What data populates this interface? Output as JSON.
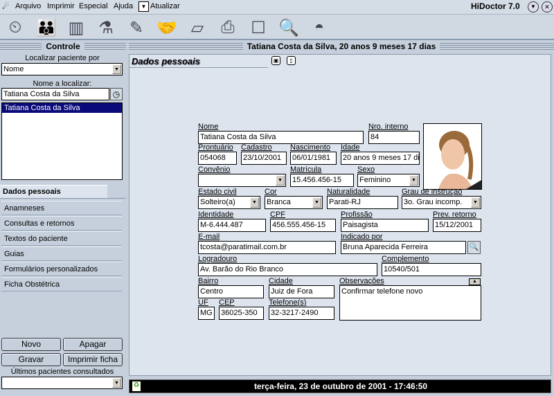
{
  "menu": {
    "items": [
      "Arquivo",
      "Imprimir",
      "Especial",
      "Ajuda"
    ],
    "refresh": "Atualizar",
    "app_title": "HiDoctor 7.0"
  },
  "toolbar": {
    "icons": [
      "agenda-icon",
      "patients-icon",
      "files-icon",
      "lab-icon",
      "notes-icon",
      "handshake-icon",
      "book-icon",
      "printer-icon",
      "device-icon",
      "search-globe-icon",
      "chart-icon"
    ]
  },
  "sidebar": {
    "header": "Controle",
    "search_by_label": "Localizar paciente por",
    "search_by_value": "Nome",
    "name_label": "Nome a localizar:",
    "name_value": "Tatiana Costa da Silva",
    "results": [
      "Tatiana Costa da Silva"
    ],
    "tabs": [
      "Dados pessoais",
      "Anamneses",
      "Consultas e retornos",
      "Textos do paciente",
      "Guias",
      "Formulários personalizados",
      "Ficha Obstétrica"
    ],
    "buttons": {
      "new": "Novo",
      "delete": "Apagar",
      "save": "Gravar",
      "print": "Imprimir ficha"
    },
    "recent_label": "Últimos pacientes consultados",
    "recent_value": ""
  },
  "patient_header": "Tatiana Costa da Silva, 20 anos 9 meses 17 dias",
  "panel_title": "Dados pessoais",
  "form": {
    "nome": {
      "label": "Nome",
      "value": "Tatiana Costa da Silva"
    },
    "nro": {
      "label": "Nro. interno",
      "value": "84"
    },
    "prontuario": {
      "label": "Prontuário",
      "value": "054068"
    },
    "cadastro": {
      "label": "Cadastro",
      "value": "23/10/2001"
    },
    "nascimento": {
      "label": "Nascimento",
      "value": "06/01/1981"
    },
    "idade": {
      "label": "Idade",
      "value": "20 anos 9 meses 17 di"
    },
    "convenio": {
      "label": "Convênio",
      "value": ""
    },
    "matricula": {
      "label": "Matrícula",
      "value": "15.456.456-15"
    },
    "sexo": {
      "label": "Sexo",
      "value": "Feminino"
    },
    "estado_civil": {
      "label": "Estado civil",
      "value": "Solteiro(a)"
    },
    "cor": {
      "label": "Cor",
      "value": "Branca"
    },
    "naturalidade": {
      "label": "Naturalidade",
      "value": "Parati-RJ"
    },
    "grau": {
      "label": "Grau de instrução",
      "value": "3o. Grau incomp."
    },
    "identidade": {
      "label": "Identidade",
      "value": "M-6.444.487"
    },
    "cpf": {
      "label": "CPF",
      "value": "456.555.456-15"
    },
    "profissao": {
      "label": "Profissão",
      "value": "Paisagista"
    },
    "prev": {
      "label": "Prev. retorno",
      "value": "15/12/2001"
    },
    "email": {
      "label": "E-mail",
      "value": "tcosta@paratimail.com.br"
    },
    "indicado": {
      "label": "Indicado por",
      "value": "Bruna Aparecida Ferreira"
    },
    "logradouro": {
      "label": "Logradouro",
      "value": "Av. Barão do Rio Branco"
    },
    "complemento": {
      "label": "Complemento",
      "value": "10540/501"
    },
    "bairro": {
      "label": "Bairro",
      "value": "Centro"
    },
    "cidade": {
      "label": "Cidade",
      "value": "Juiz de Fora"
    },
    "obs": {
      "label": "Observações",
      "value": "Confirmar telefone novo"
    },
    "uf": {
      "label": "UF",
      "value": "MG"
    },
    "cep": {
      "label": "CEP",
      "value": "36025-350"
    },
    "telefone": {
      "label": "Telefone(s)",
      "value": "32-3217-2490"
    }
  },
  "status": {
    "datetime": "terça-feira, 23 de outubro de 2001 - 17:46:50"
  }
}
